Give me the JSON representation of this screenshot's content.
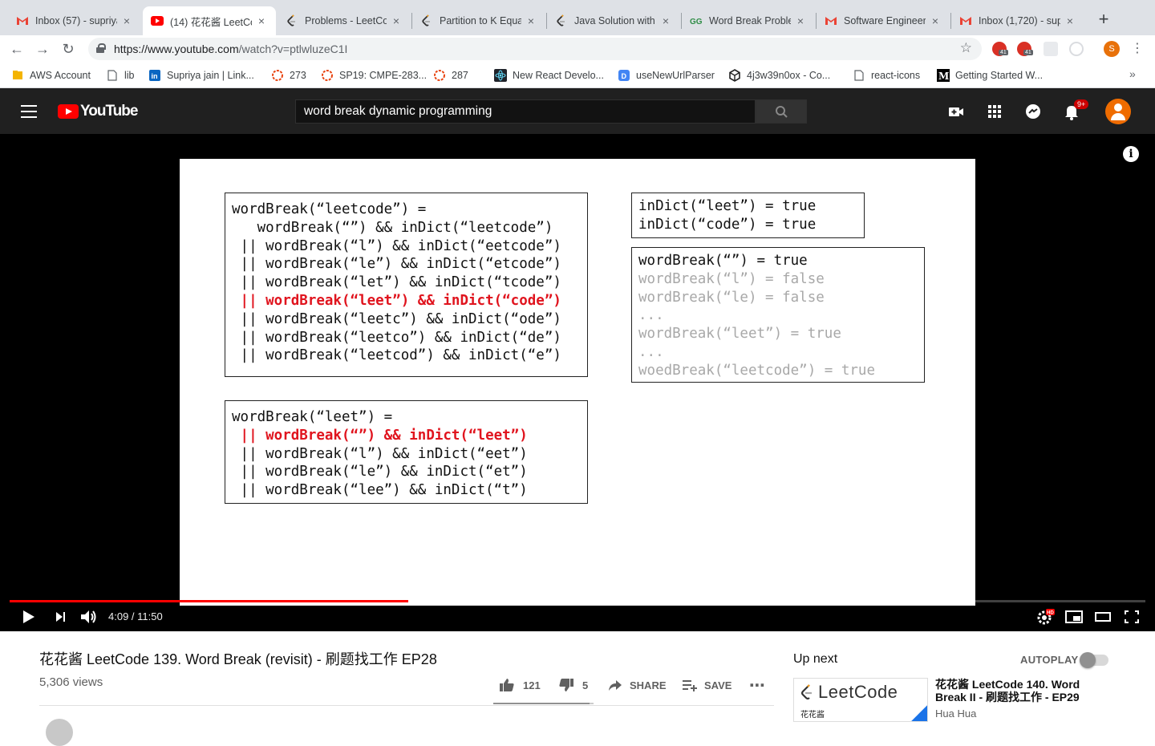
{
  "browser": {
    "tabs": [
      {
        "title": "Inbox (57) - supriya",
        "icon": "gmail-icon",
        "active": false
      },
      {
        "title": "(14) 花花酱 LeetCo",
        "icon": "youtube-icon",
        "active": true
      },
      {
        "title": "Problems - LeetCo",
        "icon": "leetcode-icon",
        "active": false
      },
      {
        "title": "Partition to K Equa",
        "icon": "leetcode-icon",
        "active": false
      },
      {
        "title": "Java Solution with",
        "icon": "leetcode-icon",
        "active": false
      },
      {
        "title": "Word Break Proble",
        "icon": "geeksforgeeks-icon",
        "active": false
      },
      {
        "title": "Software Engineer",
        "icon": "gmail-icon",
        "active": false
      },
      {
        "title": "Inbox (1,720) - sup",
        "icon": "gmail-icon",
        "active": false
      }
    ],
    "url_main": "https://www.youtube.com",
    "url_rest": "/watch?v=ptlwluzeC1I",
    "extension_badge_1": "41",
    "extension_badge_2": "41",
    "profile_initial": "S",
    "bookmarks": [
      {
        "label": "AWS Account",
        "icon": "folder-icon"
      },
      {
        "label": "lib",
        "icon": "page-icon"
      },
      {
        "label": "Supriya jain | Link...",
        "icon": "linkedin-icon"
      },
      {
        "label": "273",
        "icon": "leetcode-ring-icon"
      },
      {
        "label": "SP19: CMPE-283...",
        "icon": "leetcode-ring-icon"
      },
      {
        "label": "287",
        "icon": "leetcode-ring-icon"
      },
      {
        "label": "New React Develo...",
        "icon": "react-icon"
      },
      {
        "label": "useNewUrlParser",
        "icon": "mongo-icon"
      },
      {
        "label": "4j3w39n0ox - Co...",
        "icon": "codesandbox-icon"
      },
      {
        "label": "react-icons",
        "icon": "page-icon"
      },
      {
        "label": "Getting Started W...",
        "icon": "medium-icon"
      }
    ]
  },
  "youtube": {
    "logo_text": "YouTube",
    "search_value": "word break dynamic programming",
    "notification_count": "9+"
  },
  "slide": {
    "box1": [
      {
        "prefix": "",
        "text": "wordBreak(“leetcode”) =",
        "style": "normal"
      },
      {
        "prefix": "   ",
        "text": "   wordBreak(“”) && inDict(“leetcode”)",
        "style": "normal"
      },
      {
        "prefix": "",
        "text": " || wordBreak(“l”) && inDict(“eetcode”)",
        "style": "normal"
      },
      {
        "prefix": "",
        "text": " || wordBreak(“le”) && inDict(“etcode”)",
        "style": "normal"
      },
      {
        "prefix": "",
        "text": " || wordBreak(“let”) && inDict(“tcode”)",
        "style": "normal"
      },
      {
        "prefix": "",
        "text": " || wordBreak(“leet”) && inDict(“code”)",
        "style": "red"
      },
      {
        "prefix": "",
        "text": " || wordBreak(“leetc”) && inDict(“ode”)",
        "style": "normal"
      },
      {
        "prefix": "",
        "text": " || wordBreak(“leetco”) && inDict(“de”)",
        "style": "normal"
      },
      {
        "prefix": "",
        "text": " || wordBreak(“leetcod”) && inDict(“e”)",
        "style": "normal"
      }
    ],
    "box2": [
      {
        "text": "wordBreak(“leet”) =",
        "style": "normal"
      },
      {
        "text": " || wordBreak(“”) && inDict(“leet”)",
        "style": "red"
      },
      {
        "text": " || wordBreak(“l”) && inDict(“eet”)",
        "style": "normal"
      },
      {
        "text": " || wordBreak(“le”) && inDict(“et”)",
        "style": "normal"
      },
      {
        "text": " || wordBreak(“lee”) && inDict(“t”)",
        "style": "normal"
      }
    ],
    "box3": [
      {
        "text": "inDict(“leet”) = true",
        "style": "normal"
      },
      {
        "text": "inDict(“code”) = true",
        "style": "normal"
      }
    ],
    "box4": [
      {
        "text": "wordBreak(“”) = true",
        "style": "normal"
      },
      {
        "text": "wordBreak(“l”) = false",
        "style": "gray"
      },
      {
        "text": "wordBreak(“le) = false",
        "style": "gray"
      },
      {
        "text": "...",
        "style": "gray"
      },
      {
        "text": "wordBreak(“leet”) = true",
        "style": "gray"
      },
      {
        "text": "...",
        "style": "gray"
      },
      {
        "text": "woedBreak(“leetcode”) = true",
        "style": "gray"
      }
    ]
  },
  "player": {
    "time_display": "4:09 / 11:50",
    "played_fraction": 0.351,
    "buffered_fraction": 0.39,
    "quality_badge": "HD"
  },
  "video": {
    "title": "花花酱 LeetCode 139. Word Break (revisit) - 刷题找工作 EP28",
    "views": "5,306 views",
    "likes": "121",
    "dislikes": "5",
    "share_label": "SHARE",
    "save_label": "SAVE",
    "like_fraction": 0.96
  },
  "sidebar": {
    "up_next_label": "Up next",
    "autoplay_label": "AUTOPLAY",
    "autoplay_on": false,
    "next_video": {
      "thumb_brand": "LeetCode",
      "thumb_sub": "花花酱",
      "title": "花花酱 LeetCode 140. Word Break II - 刷题找工作 - EP29",
      "channel": "Hua Hua"
    }
  },
  "colors": {
    "youtube_red": "#ff0000",
    "masthead": "#202020",
    "slide_highlight": "#e0141e"
  }
}
